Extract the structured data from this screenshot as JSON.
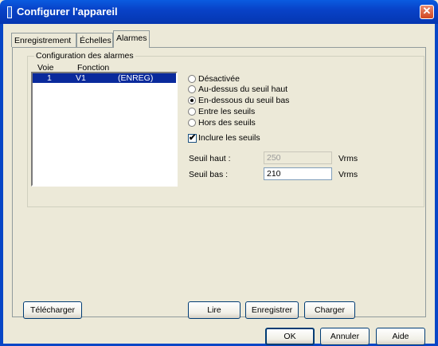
{
  "window": {
    "title": "Configurer l'appareil",
    "close_glyph": "✕"
  },
  "tabs": [
    {
      "label": "Enregistrement",
      "active": false
    },
    {
      "label": "Échelles",
      "active": false
    },
    {
      "label": "Alarmes",
      "active": true
    }
  ],
  "alarm_group": {
    "title": "Configuration des alarmes",
    "columns": [
      "Voie",
      "Fonction"
    ],
    "rows": [
      {
        "voie": "1",
        "fonction": "V1",
        "mode": "(ENREG)",
        "selected": true
      }
    ]
  },
  "options": {
    "radios": [
      {
        "label": "Désactivée",
        "checked": false
      },
      {
        "label": "Au-dessus du seuil haut",
        "checked": false
      },
      {
        "label": "En-dessous du seuil bas",
        "checked": true
      },
      {
        "label": "Entre les seuils",
        "checked": false
      },
      {
        "label": "Hors des seuils",
        "checked": false
      }
    ],
    "include_label": "Inclure les seuils",
    "include_checked": true
  },
  "thresholds": {
    "high": {
      "label": "Seuil haut :",
      "value": "250",
      "unit": "Vrms",
      "disabled": true
    },
    "low": {
      "label": "Seuil bas :",
      "value": "210",
      "unit": "Vrms",
      "disabled": false
    }
  },
  "panel_buttons": {
    "download": "Télécharger",
    "read": "Lire",
    "save": "Enregistrer",
    "load": "Charger"
  },
  "dialog_buttons": {
    "ok": "OK",
    "cancel": "Annuler",
    "help": "Aide"
  },
  "colors": {
    "titlebar": "#0842c8",
    "selection": "#0a2a9c",
    "dialog_bg": "#ece9d8"
  }
}
